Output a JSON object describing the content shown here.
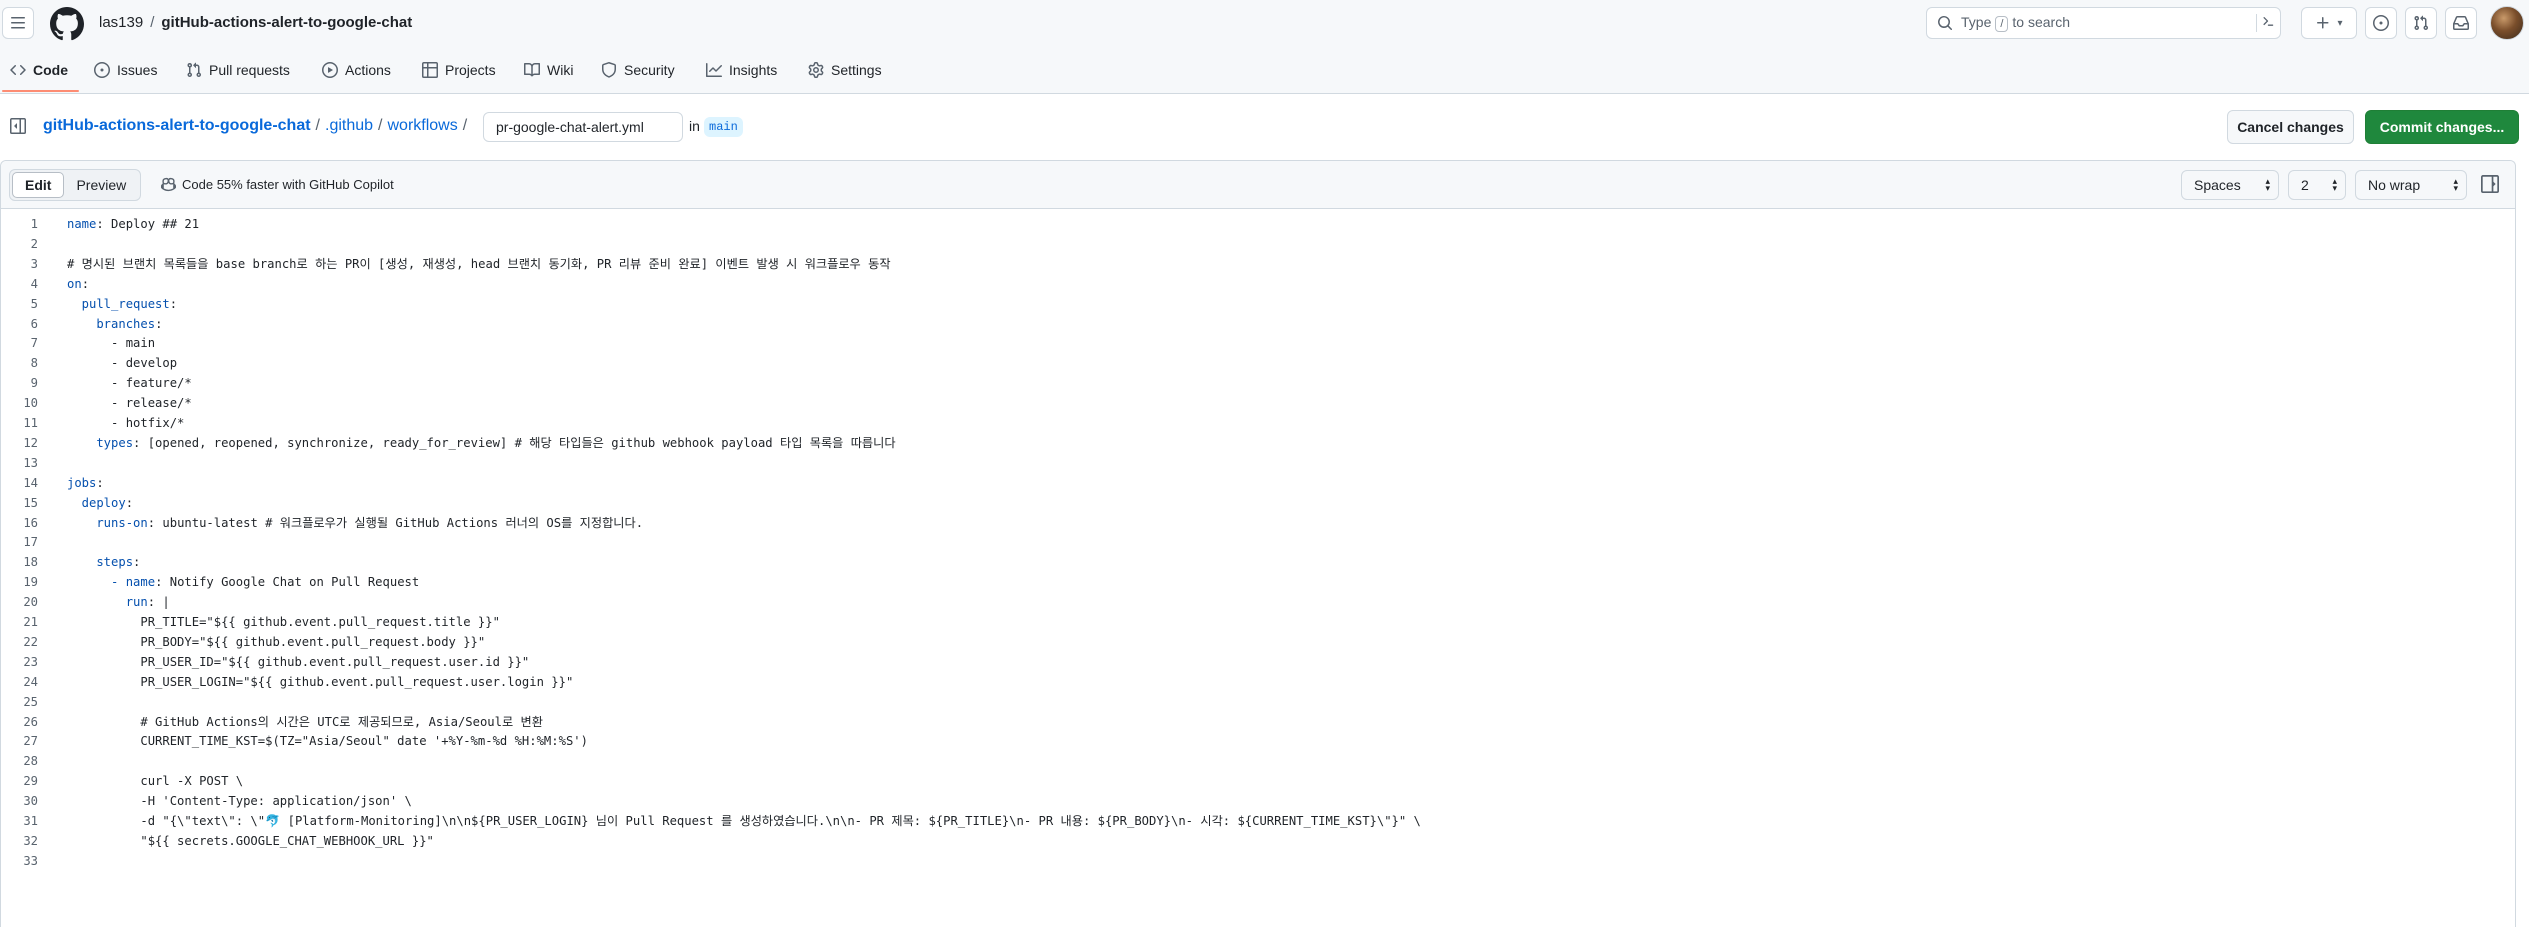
{
  "header": {
    "owner": "las139",
    "separator": "/",
    "repo": "gitHub-actions-alert-to-google-chat",
    "search": {
      "prefix": "Type",
      "key": "/",
      "suffix": "to search"
    },
    "plus_caret": "▾"
  },
  "nav": {
    "items": [
      {
        "label": "Code",
        "icon": "code-icon",
        "selected": true
      },
      {
        "label": "Issues",
        "icon": "issue-icon"
      },
      {
        "label": "Pull requests",
        "icon": "pull-request-icon"
      },
      {
        "label": "Actions",
        "icon": "play-icon"
      },
      {
        "label": "Projects",
        "icon": "table-icon"
      },
      {
        "label": "Wiki",
        "icon": "book-icon"
      },
      {
        "label": "Security",
        "icon": "shield-icon"
      },
      {
        "label": "Insights",
        "icon": "graph-icon"
      },
      {
        "label": "Settings",
        "icon": "gear-icon"
      }
    ]
  },
  "editbar": {
    "repo_link": "gitHub-actions-alert-to-google-chat",
    "path": [
      ".github",
      "workflows"
    ],
    "slash": "/",
    "filename": "pr-google-chat-alert.yml",
    "in_label": "in",
    "branch": "main",
    "cancel_label": "Cancel changes",
    "commit_label": "Commit changes..."
  },
  "editor": {
    "tabs": {
      "edit": "Edit",
      "preview": "Preview"
    },
    "copilot_hint": "Code 55% faster with GitHub Copilot",
    "indent_mode": "Spaces",
    "indent_size": "2",
    "wrap_mode": "No wrap",
    "lines": [
      {
        "n": "1",
        "k": "name",
        "v": ": Deploy ## 21"
      },
      {
        "n": "2",
        "k": "",
        "v": ""
      },
      {
        "n": "3",
        "k": "",
        "v": "# 명시된 브랜치 목록들을 base branch로 하는 PR이 [생성, 재생성, head 브랜치 동기화, PR 리뷰 준비 완료] 이벤트 발생 시 워크플로우 동작"
      },
      {
        "n": "4",
        "k": "on",
        "v": ":"
      },
      {
        "n": "5",
        "k": "  pull_request",
        "v": ":"
      },
      {
        "n": "6",
        "k": "    branches",
        "v": ":"
      },
      {
        "n": "7",
        "k": "",
        "v": "      - main"
      },
      {
        "n": "8",
        "k": "",
        "v": "      - develop"
      },
      {
        "n": "9",
        "k": "",
        "v": "      - feature/*"
      },
      {
        "n": "10",
        "k": "",
        "v": "      - release/*"
      },
      {
        "n": "11",
        "k": "",
        "v": "      - hotfix/*"
      },
      {
        "n": "12",
        "k": "    types",
        "v": ": [opened, reopened, synchronize, ready_for_review] # 해당 타입들은 github webhook payload 타입 목록을 따릅니다"
      },
      {
        "n": "13",
        "k": "",
        "v": ""
      },
      {
        "n": "14",
        "k": "jobs",
        "v": ":"
      },
      {
        "n": "15",
        "k": "  deploy",
        "v": ":"
      },
      {
        "n": "16",
        "k": "    runs-on",
        "v": ": ubuntu-latest # 워크플로우가 실행될 GitHub Actions 러너의 OS를 지정합니다."
      },
      {
        "n": "17",
        "k": "",
        "v": ""
      },
      {
        "n": "18",
        "k": "    steps",
        "v": ":"
      },
      {
        "n": "19",
        "k": "      - name",
        "v": ": Notify Google Chat on Pull Request"
      },
      {
        "n": "20",
        "k": "        run",
        "v": ": |"
      },
      {
        "n": "21",
        "k": "",
        "v": "          PR_TITLE=\"${{ github.event.pull_request.title }}\""
      },
      {
        "n": "22",
        "k": "",
        "v": "          PR_BODY=\"${{ github.event.pull_request.body }}\""
      },
      {
        "n": "23",
        "k": "",
        "v": "          PR_USER_ID=\"${{ github.event.pull_request.user.id }}\""
      },
      {
        "n": "24",
        "k": "",
        "v": "          PR_USER_LOGIN=\"${{ github.event.pull_request.user.login }}\""
      },
      {
        "n": "25",
        "k": "",
        "v": ""
      },
      {
        "n": "26",
        "k": "",
        "v": "          # GitHub Actions의 시간은 UTC로 제공되므로, Asia/Seoul로 변환"
      },
      {
        "n": "27",
        "k": "",
        "v": "          CURRENT_TIME_KST=$(TZ=\"Asia/Seoul\" date '+%Y-%m-%d %H:%M:%S')"
      },
      {
        "n": "28",
        "k": "",
        "v": ""
      },
      {
        "n": "29",
        "k": "",
        "v": "          curl -X POST \\"
      },
      {
        "n": "30",
        "k": "",
        "v": "          -H 'Content-Type: application/json' \\"
      },
      {
        "n": "31",
        "k": "",
        "v": "          -d \"{\\\"text\\\": \\\"🐬 [Platform-Monitoring]\\n\\n${PR_USER_LOGIN} 님이 Pull Request 를 생성하였습니다.\\n\\n- PR 제목: ${PR_TITLE}\\n- PR 내용: ${PR_BODY}\\n- 시각: ${CURRENT_TIME_KST}\\\"}\" \\"
      },
      {
        "n": "32",
        "k": "",
        "v": "          \"${{ secrets.GOOGLE_CHAT_WEBHOOK_URL }}\""
      },
      {
        "n": "33",
        "k": "",
        "v": ""
      }
    ]
  },
  "colors": {
    "accent_link": "#0969da",
    "commit_green": "#1f883d",
    "nav_underline": "#fd8c73",
    "yaml_key": "#0550ae"
  }
}
